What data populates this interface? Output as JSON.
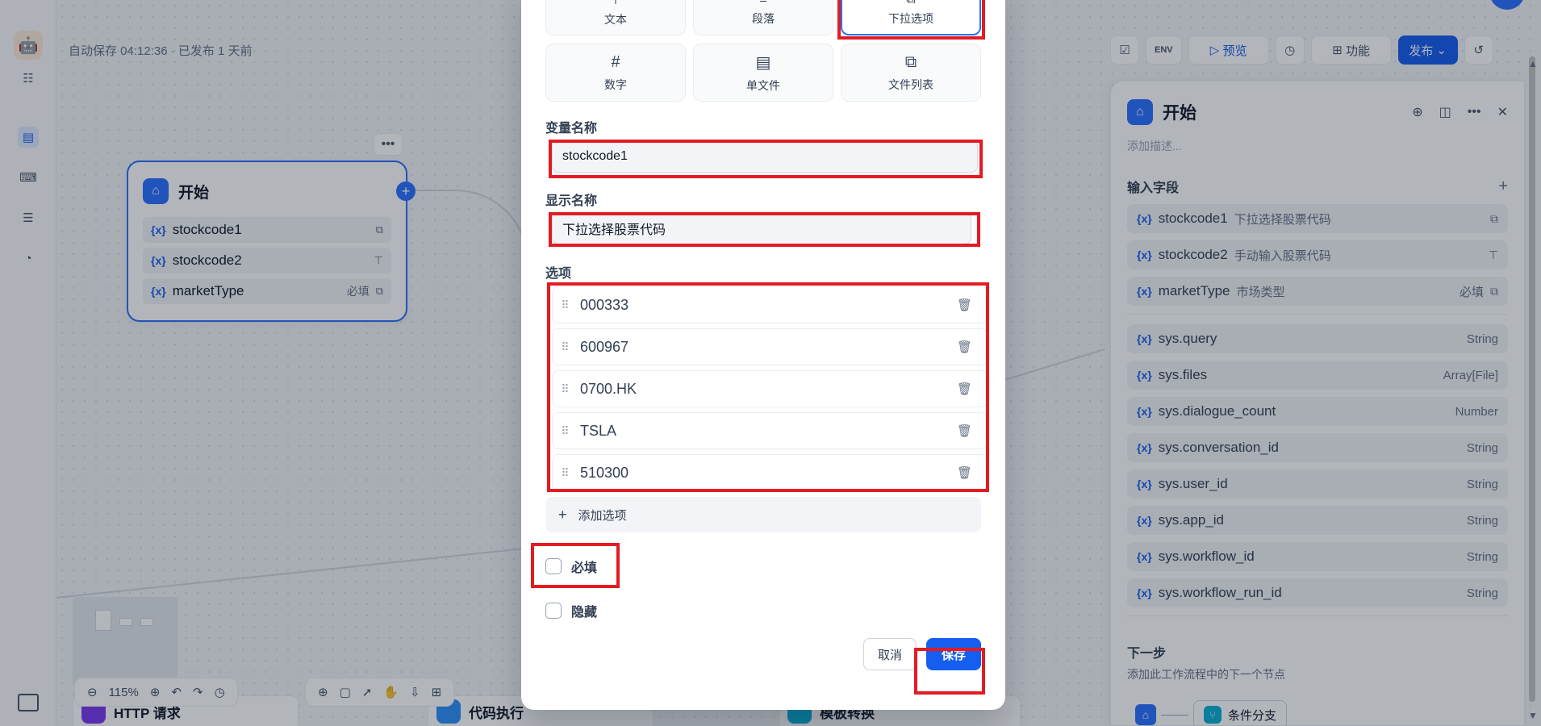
{
  "background": {
    "autosave": "自动保存 04:12:36 · 已发布 1 天前",
    "toolbar": {
      "env": "ENV",
      "preview": "预览",
      "feature": "功能",
      "publish": "发布"
    },
    "zoom": "115%",
    "start_node": {
      "title": "开始",
      "vars": [
        {
          "name": "stockcode1",
          "required": ""
        },
        {
          "name": "stockcode2",
          "required": ""
        },
        {
          "name": "marketType",
          "required": "必填"
        }
      ]
    },
    "bottom_nodes": [
      "HTTP 请求",
      "代码执行",
      "模板转换"
    ]
  },
  "panel": {
    "title": "开始",
    "desc_placeholder": "添加描述...",
    "input_fields_label": "输入字段",
    "fields": [
      {
        "name": "stockcode1",
        "sub": "下拉选择股票代码",
        "type": ""
      },
      {
        "name": "stockcode2",
        "sub": "手动输入股票代码",
        "type": ""
      },
      {
        "name": "marketType",
        "sub": "市场类型",
        "type": "必填"
      }
    ],
    "sys_vars": [
      {
        "name": "sys.query",
        "type": "String"
      },
      {
        "name": "sys.files",
        "type": "Array[File]"
      },
      {
        "name": "sys.dialogue_count",
        "type": "Number"
      },
      {
        "name": "sys.conversation_id",
        "type": "String"
      },
      {
        "name": "sys.user_id",
        "type": "String"
      },
      {
        "name": "sys.app_id",
        "type": "String"
      },
      {
        "name": "sys.workflow_id",
        "type": "String"
      },
      {
        "name": "sys.workflow_run_id",
        "type": "String"
      }
    ],
    "next_step_title": "下一步",
    "next_step_desc": "添加此工作流程中的下一个节点",
    "next_node": "条件分支"
  },
  "modal": {
    "types_top": [
      "文本",
      "段落",
      "下拉选项"
    ],
    "types_bottom": [
      "数字",
      "单文件",
      "文件列表"
    ],
    "selected_type": "下拉选项",
    "var_name_label": "变量名称",
    "var_name_value": "stockcode1",
    "display_name_label": "显示名称",
    "display_name_value": "下拉选择股票代码",
    "options_label": "选项",
    "options": [
      "000333",
      "600967",
      "0700.HK",
      "TSLA",
      "510300"
    ],
    "add_option": "添加选项",
    "required_label": "必填",
    "required_checked": false,
    "hidden_label": "隐藏",
    "hidden_checked": false,
    "cancel": "取消",
    "save": "保存"
  },
  "colors": {
    "accent": "#155eef",
    "highlight": "#e31b23",
    "node_border": "#2970ff"
  }
}
